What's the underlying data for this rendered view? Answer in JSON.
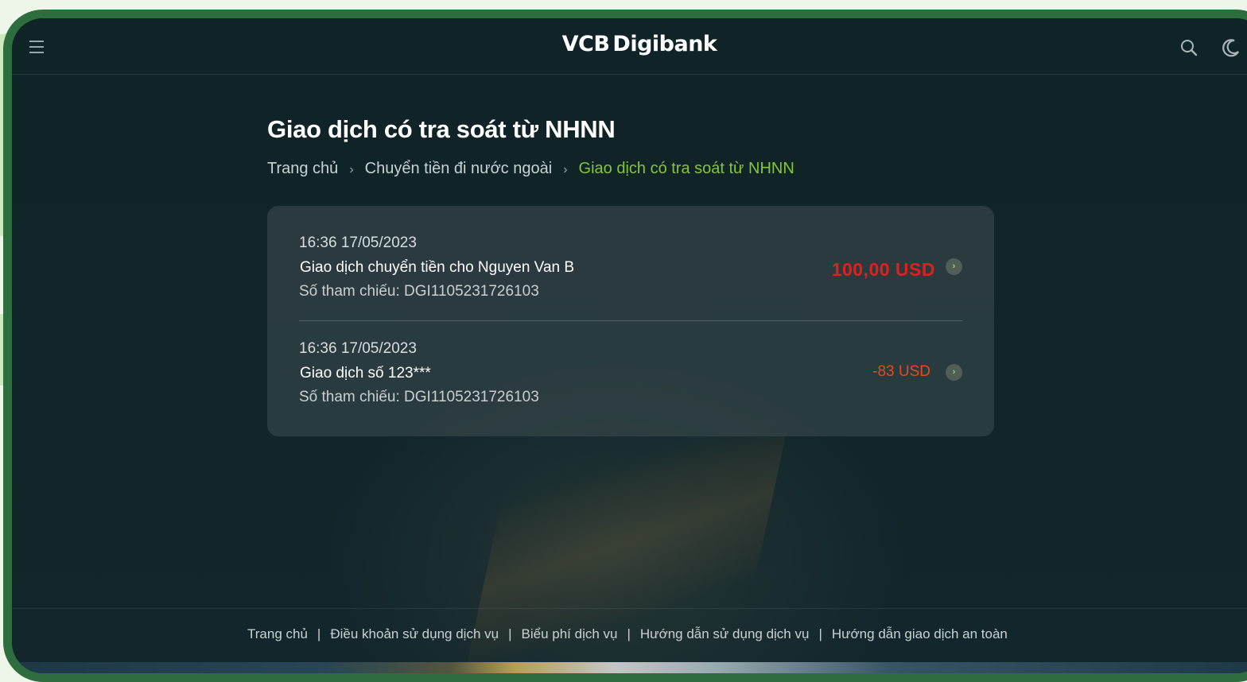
{
  "header": {
    "logo_bold": "VCB",
    "logo_rest": "Digibank"
  },
  "page_title": "Giao dịch có tra soát từ NHNN",
  "breadcrumb": [
    {
      "label": "Trang chủ"
    },
    {
      "label": "Chuyển tiền đi nước ngoài"
    },
    {
      "label": "Giao dịch có tra soát từ NHNN"
    }
  ],
  "transactions": [
    {
      "time": "16:36 17/05/2023",
      "description": "Giao dịch chuyển tiền cho Nguyen Van B",
      "reference": "Số tham chiếu: DGI1105231726103",
      "amount": "100,00 USD",
      "amount_color": "#e0201f"
    },
    {
      "time": "16:36 17/05/2023",
      "description": "Giao dịch số 123***",
      "reference": "Số tham chiếu: DGI1105231726103",
      "amount": "-83 USD",
      "amount_color": "#e04d1d"
    }
  ],
  "footer": {
    "links": [
      "Trang chủ",
      "Điều khoản sử dụng dịch vụ",
      "Biểu phí dịch vụ",
      "Hướng dẫn sử dụng dịch vụ",
      "Hướng dẫn giao dịch an toàn"
    ],
    "separator": "|"
  },
  "icons": {
    "menu": "menu-icon",
    "search": "search-icon",
    "theme": "moon-icon",
    "row_arrow": "chevron-right-icon"
  },
  "colors": {
    "background": "#0f2226",
    "accent_green": "#86c43a",
    "frame_green": "#2e6d3d",
    "amount_red": "#e0201f"
  }
}
